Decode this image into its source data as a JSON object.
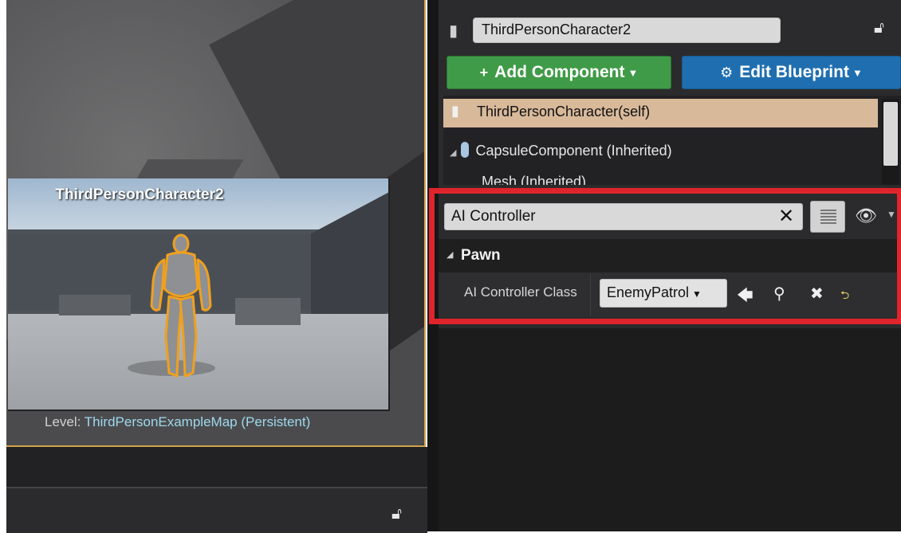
{
  "viewport": {
    "preview_title": "ThirdPersonCharacter2",
    "level_label": "Level:",
    "level_name": "ThirdPersonExampleMap (Persistent)"
  },
  "details": {
    "actor_name": "ThirdPersonCharacter2",
    "add_component_label": "Add Component",
    "edit_blueprint_label": "Edit Blueprint",
    "components": {
      "self": "ThirdPersonCharacter(self)",
      "capsule": "CapsuleComponent (Inherited)",
      "mesh": "Mesh (Inherited)"
    },
    "search_value": "AI Controller",
    "category": "Pawn",
    "property": {
      "label": "AI Controller Class",
      "value": "EnemyPatrol"
    }
  },
  "colors": {
    "add_component": "#3f9b47",
    "edit_blueprint": "#1f6fb0",
    "highlight": "#e0242b",
    "selection": "#d8b99a"
  },
  "icons": [
    "lock-icon",
    "actor-icon",
    "plus-icon",
    "gears-icon",
    "capsule-icon",
    "clear-icon",
    "grid-icon",
    "eye-icon",
    "arrow-left-icon",
    "magnifier-icon",
    "close-icon",
    "reset-icon"
  ]
}
